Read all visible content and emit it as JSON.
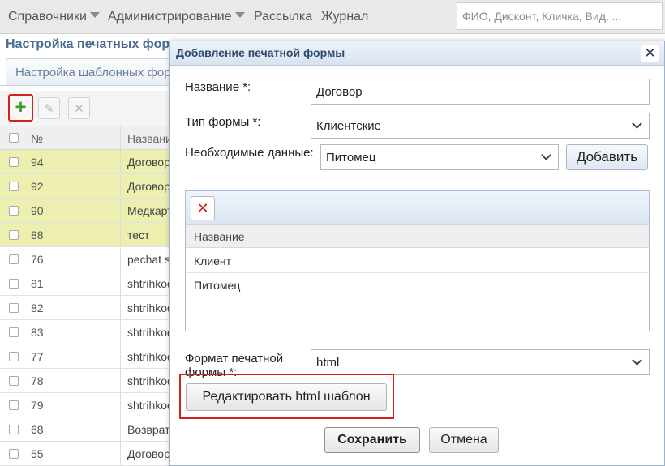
{
  "topbar": {
    "menu": [
      {
        "label": "Справочники",
        "dropdown": true
      },
      {
        "label": "Администрирование",
        "dropdown": true
      },
      {
        "label": "Рассылка",
        "dropdown": false
      },
      {
        "label": "Журнал",
        "dropdown": false
      }
    ],
    "search_placeholder": "ФИО, Дисконт, Кличка, Вид, ..."
  },
  "page": {
    "title": "Настройка печатных форм",
    "tab_label": "Настройка шаблонных форм"
  },
  "toolbar": {
    "add_icon": "plus-icon",
    "add_glyph": "+",
    "edit_icon": "pencil-icon",
    "edit_glyph": "✎",
    "delete_icon": "cross-icon",
    "delete_glyph": "✕"
  },
  "grid": {
    "columns": [
      "№",
      "Название"
    ],
    "rows": [
      {
        "num": "94",
        "name": "Договор",
        "highlighted": true
      },
      {
        "num": "92",
        "name": "Договор",
        "highlighted": true
      },
      {
        "num": "90",
        "name": "Медкарта",
        "highlighted": true
      },
      {
        "num": "88",
        "name": "тест",
        "highlighted": true
      },
      {
        "num": "76",
        "name": "pechat s",
        "highlighted": false
      },
      {
        "num": "81",
        "name": "shtrihkod",
        "highlighted": false
      },
      {
        "num": "82",
        "name": "shtrihkod",
        "highlighted": false
      },
      {
        "num": "83",
        "name": "shtrihkod",
        "highlighted": false
      },
      {
        "num": "77",
        "name": "shtrihkod",
        "highlighted": false
      },
      {
        "num": "78",
        "name": "shtrihkod",
        "highlighted": false
      },
      {
        "num": "79",
        "name": "shtrihkod",
        "highlighted": false
      },
      {
        "num": "68",
        "name": "Возврат",
        "highlighted": false
      },
      {
        "num": "55",
        "name": "Договор",
        "highlighted": false
      }
    ]
  },
  "dialog": {
    "title": "Добавление печатной формы",
    "close_glyph": "✕",
    "name_label": "Название *:",
    "name_value": "Договор",
    "form_type_label": "Тип формы *:",
    "form_type_value": "Клиентские",
    "required_data_label": "Необходимые данные:",
    "required_data_value": "Питомец",
    "add_button": "Добавить",
    "sub_delete_glyph": "✕",
    "sub_column": "Название",
    "sub_rows": [
      "Клиент",
      "Питомец"
    ],
    "format_label": "Формат печатной формы *:",
    "format_value": "html",
    "edit_template_button": "Редактировать html шаблон",
    "save_button": "Сохранить",
    "cancel_button": "Отмена"
  },
  "colors": {
    "highlight_row": "#ecefb0",
    "accent_red": "#d62020",
    "add_green": "#3e9a2e",
    "title_blue": "#4a6a93"
  }
}
